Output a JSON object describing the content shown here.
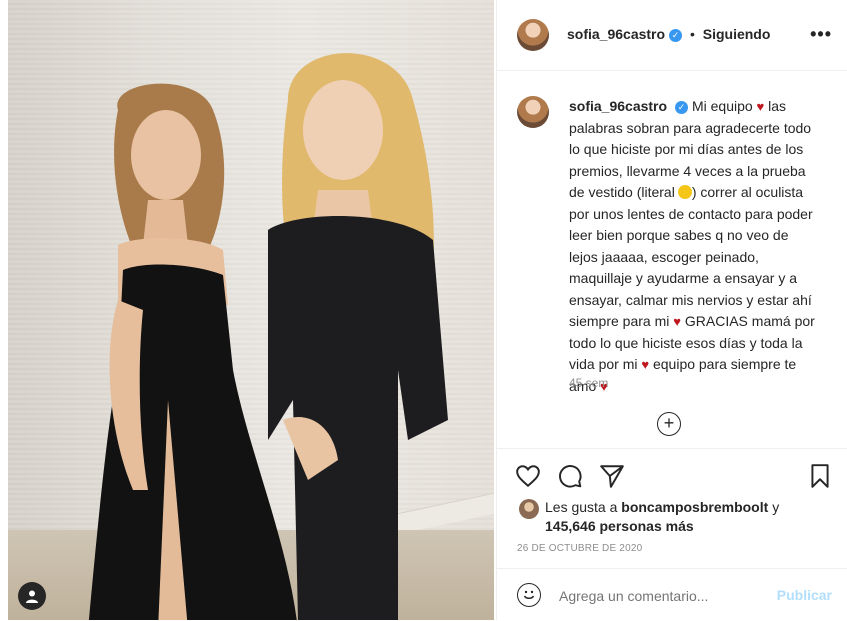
{
  "post": {
    "username": "sofia_96castro",
    "follow_status": "Siguiendo",
    "more_icon": "more-options-icon",
    "caption_lines": [
      "Mi equipo",
      "las",
      "palabras sobran para agradecerte",
      "todo lo que hiciste por mi días antes",
      "de los premios, llevarme 4 veces a la",
      "prueba de vestido (literal",
      ") correr al",
      "oculista por unos lentes de contacto",
      "para poder leer bien porque sabes q",
      "no veo de lejos jaaaaa, escoger",
      "peinado, maquillaje y ayudarme a",
      "ensayar y a ensayar, calmar mis",
      "nervios y estar ahí siempre para mi",
      "GRACIAS mamá por todo lo que",
      "hiciste esos días y toda la vida por mi",
      "equipo para siempre te amo"
    ],
    "time_ago": "45 sem",
    "likes_prefix": "Les gusta a",
    "likes_user": "boncamposbremboolt",
    "likes_and": "y",
    "likes_count": "145,646 personas más",
    "date": "26 DE OCTUBRE DE 2020",
    "comment_placeholder": "Agrega un comentario...",
    "publish_label": "Publicar"
  },
  "colors": {
    "heart": "#c0181f",
    "verified": "#3897f0",
    "publish_disabled": "#b2dffc"
  }
}
